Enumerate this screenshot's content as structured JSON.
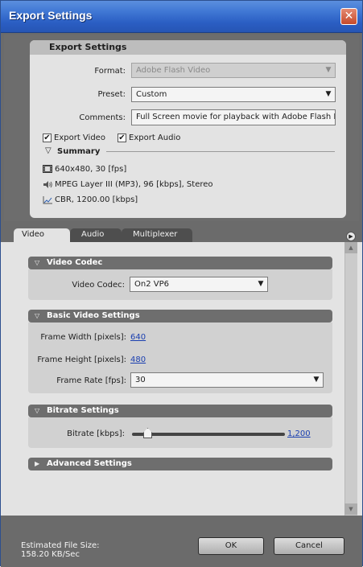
{
  "window": {
    "title": "Export Settings",
    "close_glyph": "✕"
  },
  "export_settings": {
    "header": "Export Settings",
    "format": {
      "label": "Format:",
      "value": "Adobe Flash Video"
    },
    "preset": {
      "label": "Preset:",
      "value": "Custom"
    },
    "comments": {
      "label": "Comments:",
      "value": "Full Screen movie for playback with Adobe Flash Play"
    },
    "export_video": {
      "label": "Export Video",
      "checked": true
    },
    "export_audio": {
      "label": "Export Audio",
      "checked": true
    },
    "summary": {
      "title": "Summary",
      "video": "640x480, 30 [fps]",
      "audio": "MPEG Layer III (MP3), 96 [kbps], Stereo",
      "bitrate": "CBR, 1200.00 [kbps]"
    }
  },
  "tabs": [
    {
      "label": "Video",
      "active": true
    },
    {
      "label": "Audio",
      "active": false
    },
    {
      "label": "Multiplexer",
      "active": false
    }
  ],
  "video_codec": {
    "header": "Video Codec",
    "label": "Video Codec:",
    "value": "On2 VP6"
  },
  "basic_video": {
    "header": "Basic Video Settings",
    "frame_width_label": "Frame Width [pixels]:",
    "frame_width": "640",
    "frame_height_label": "Frame Height [pixels]:",
    "frame_height": "480",
    "frame_rate_label": "Frame Rate [fps]:",
    "frame_rate": "30"
  },
  "bitrate": {
    "header": "Bitrate Settings",
    "label": "Bitrate [kbps]:",
    "value": "1,200",
    "slider_fraction": 0.1
  },
  "advanced": {
    "header": "Advanced Settings"
  },
  "footer": {
    "estimate_label": "Estimated File Size:",
    "estimate_value": "158.20 KB/Sec",
    "ok": "OK",
    "cancel": "Cancel"
  },
  "glyphs": {
    "checkmark": "✔",
    "dropdown": "▼",
    "collapse": "▽",
    "expand": "▶",
    "scroll_up": "▲",
    "scroll_down": "▼",
    "panel_menu": "▶"
  }
}
